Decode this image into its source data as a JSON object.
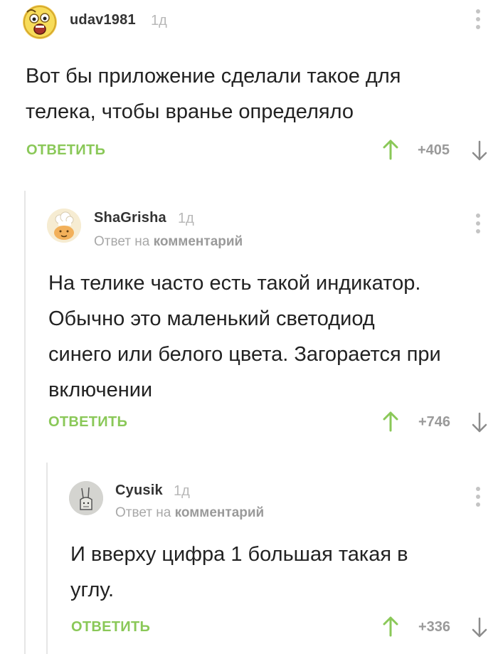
{
  "comments": [
    {
      "author": "udav1981",
      "age": "1д",
      "text_lines": [
        "Вот бы приложение сделали такое для",
        "телека, чтобы вранье определяло"
      ],
      "reply_label": "ОТВЕТИТЬ",
      "rating": "+405",
      "avatar_icon": "shocked-smiley-avatar"
    },
    {
      "author": "ShaGrisha",
      "age": "1д",
      "reply_to_prefix": "Ответ на",
      "reply_to_target": "комментарий",
      "text_lines": [
        "На телике часто есть такой индикатор.",
        "Обычно это маленький светодиод",
        "синего или белого цвета. Загорается при",
        "включении"
      ],
      "reply_label": "ОТВЕТИТЬ",
      "rating": "+746",
      "avatar_icon": "chef-avatar"
    },
    {
      "author": "Cyusik",
      "age": "1д",
      "reply_to_prefix": "Ответ на",
      "reply_to_target": "комментарий",
      "text_lines": [
        "И вверху цифра 1 большая такая в",
        "углу."
      ],
      "reply_label": "ОТВЕТИТЬ",
      "rating": "+336",
      "avatar_icon": "sketch-bunny-avatar"
    }
  ],
  "colors": {
    "accent_green": "#8ac858",
    "muted_gray": "#a8a8a8",
    "thread_line": "#e6e6e6"
  }
}
